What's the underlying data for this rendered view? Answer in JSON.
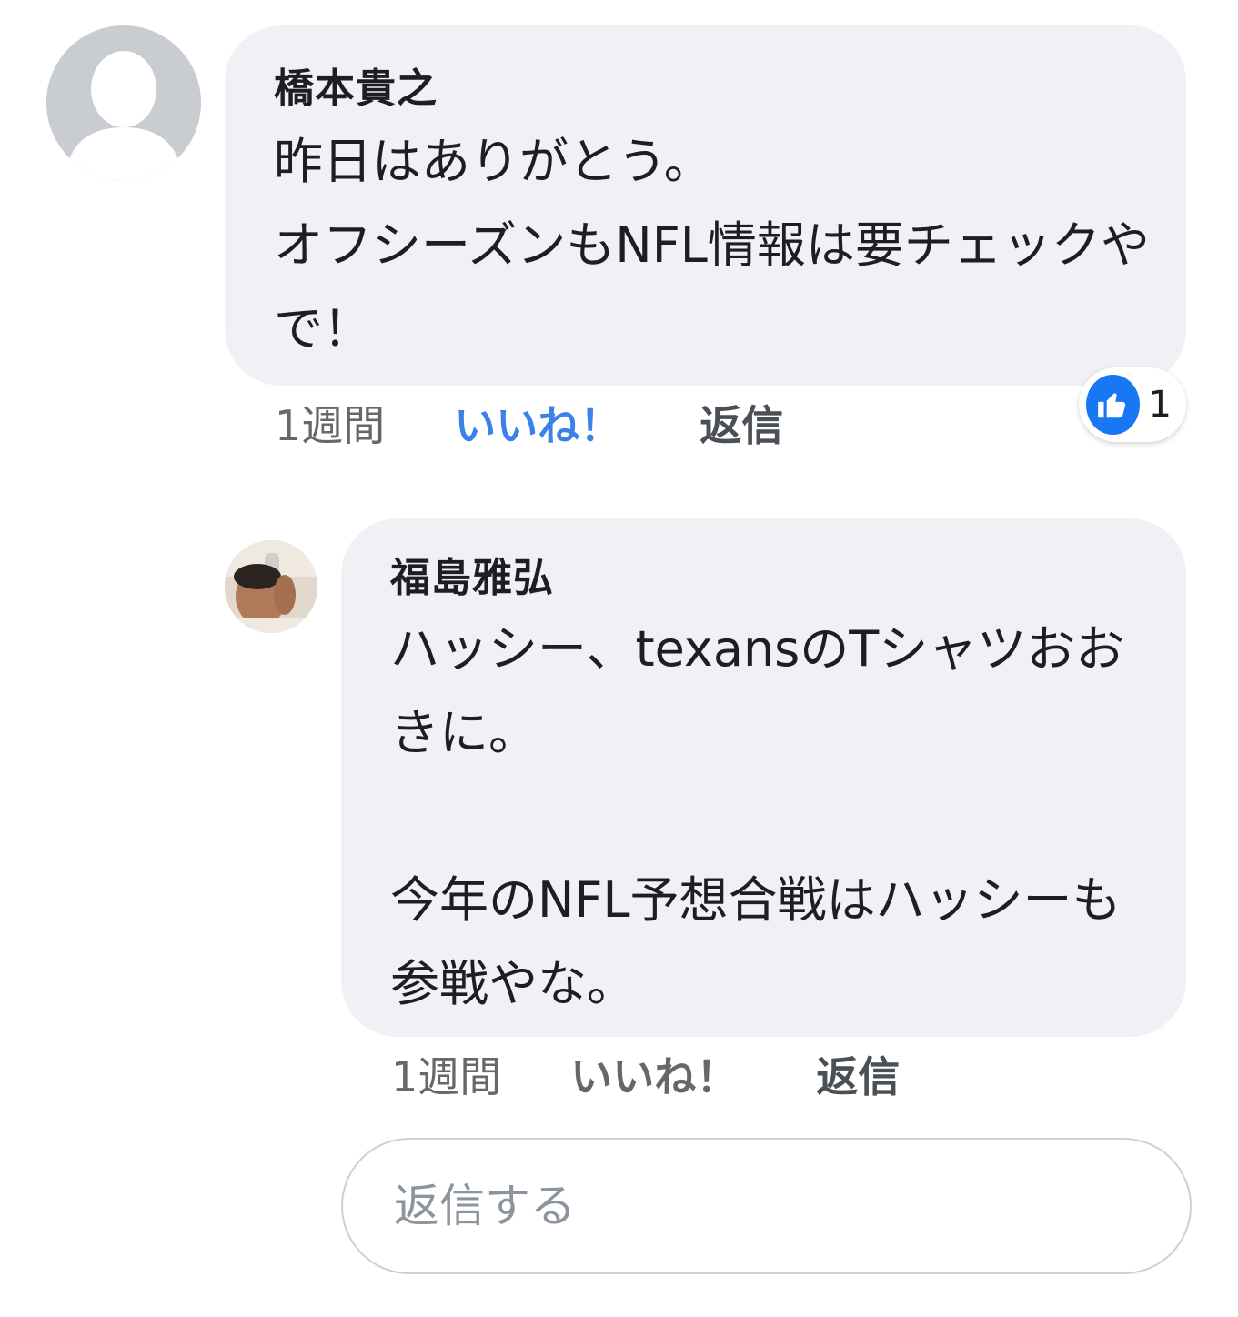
{
  "comments": [
    {
      "author": "橋本貴之",
      "text": "昨日はありがとう。\nオフシーズンもNFL情報は要チェックやで！",
      "time": "1週間",
      "like_label": "いいね！",
      "reply_label": "返信",
      "reaction_count": "1",
      "liked": true
    },
    {
      "author": "福島雅弘",
      "text": "ハッシー、texansのTシャツおおきに。\n\n今年のNFL予想合戦はハッシーも参戦やな。",
      "time": "1週間",
      "like_label": "いいね！",
      "reply_label": "返信",
      "liked": false
    }
  ],
  "reply_input": {
    "placeholder": "返信する",
    "value": ""
  },
  "colors": {
    "bubble": "#f0f1f4",
    "like_active": "#3b82e8",
    "reaction_blue": "#1877f2",
    "meta_gray": "#65676b"
  },
  "icons": {
    "default_avatar": "default-avatar-icon",
    "user_photo": "user-photo-avatar",
    "like_reaction": "thumbs-up-icon"
  }
}
